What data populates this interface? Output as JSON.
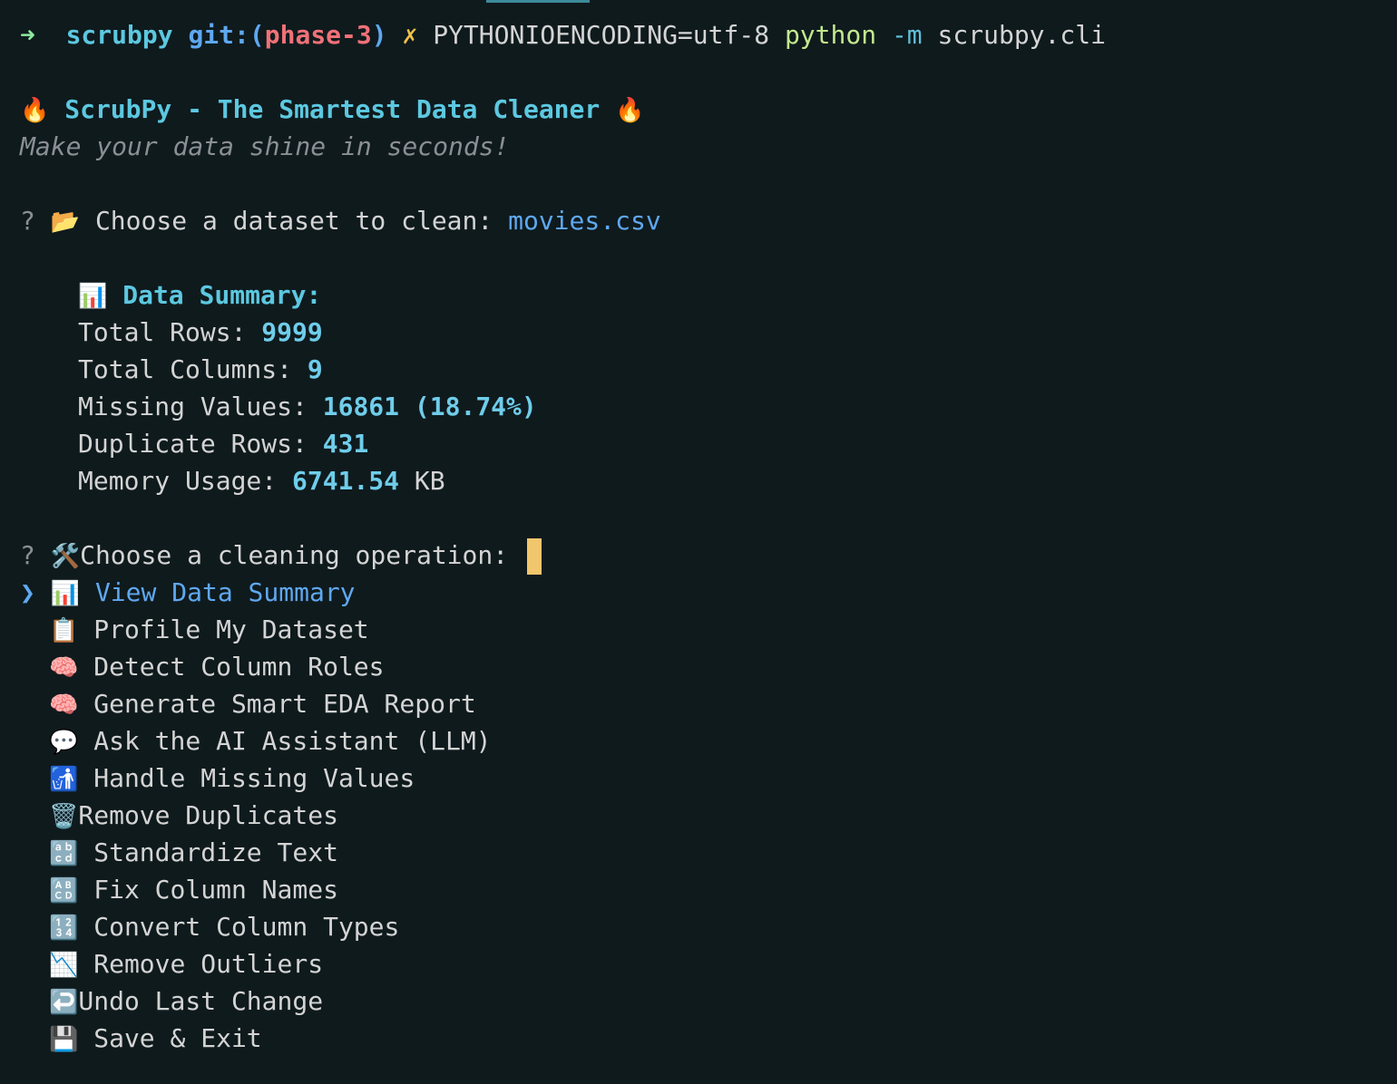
{
  "prompt": {
    "arrow": "➜",
    "dir": "scrubpy",
    "git_label": "git:",
    "branch_open": "(",
    "branch": "phase-3",
    "branch_close": ")",
    "dirty": "✗",
    "env": "PYTHONIOENCODING=utf-8",
    "python": "python",
    "flag": "-m",
    "module": "scrubpy.cli"
  },
  "banner": {
    "icon": "🔥",
    "title": "ScrubPy - The Smartest Data Cleaner",
    "icon_end": "🔥",
    "tagline": "Make your data shine in seconds!"
  },
  "dataset_question": {
    "mark": "?",
    "icon": "📂",
    "text": "Choose a dataset to clean:",
    "answer": "movies.csv"
  },
  "summary": {
    "icon": "📊",
    "heading": "Data Summary:",
    "rows": [
      {
        "label": "Total Rows:",
        "value": "9999",
        "suffix": ""
      },
      {
        "label": "Total Columns:",
        "value": "9",
        "suffix": ""
      },
      {
        "label": "Missing Values:",
        "value": "16861",
        "suffix": "(18.74%)"
      },
      {
        "label": "Duplicate Rows:",
        "value": "431",
        "suffix": ""
      },
      {
        "label": "Memory Usage:",
        "value": "6741.54",
        "suffix": "KB"
      }
    ]
  },
  "operation_question": {
    "mark": "?",
    "icon": "🛠️",
    "text": "Choose a cleaning operation:"
  },
  "menu": {
    "pointer": "❯",
    "selected_index": 0,
    "items": [
      {
        "icon": "📊",
        "label": "View Data Summary"
      },
      {
        "icon": "📋",
        "label": "Profile My Dataset"
      },
      {
        "icon": "🧠",
        "label": "Detect Column Roles"
      },
      {
        "icon": "🧠",
        "label": "Generate Smart EDA Report"
      },
      {
        "icon": "💬",
        "label": "Ask the AI Assistant (LLM)"
      },
      {
        "icon": "🚮",
        "label": "Handle Missing Values"
      },
      {
        "icon": "🗑️",
        "label": "Remove Duplicates"
      },
      {
        "icon": "🔡",
        "label": "Standardize Text"
      },
      {
        "icon": "🔠",
        "label": "Fix Column Names"
      },
      {
        "icon": "🔢",
        "label": "Convert Column Types"
      },
      {
        "icon": "📉",
        "label": "Remove Outliers"
      },
      {
        "icon": "↩️",
        "label": "Undo Last Change"
      },
      {
        "icon": "💾",
        "label": "Save & Exit"
      }
    ]
  },
  "colors": {
    "background": "#0f1a1d",
    "accent_cyan": "#5cc8e0",
    "selection_blue": "#5fa8f0",
    "cursor": "#f2c66d"
  }
}
